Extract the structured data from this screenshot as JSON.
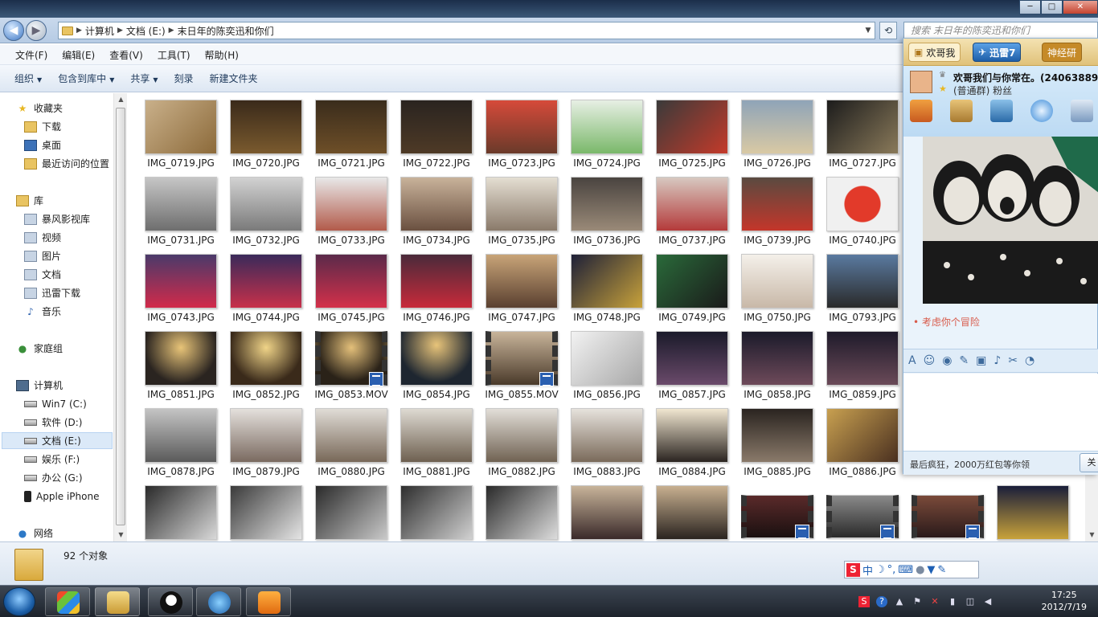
{
  "window": {
    "title_buttons": [
      "─",
      "□",
      "✕"
    ]
  },
  "address": {
    "crumbs": [
      "计算机",
      "文档 (E:)",
      "末日年的陈奕迅和你们"
    ],
    "search_placeholder": "搜索 末日年的陈奕迅和你们"
  },
  "menu": [
    "文件(F)",
    "编辑(E)",
    "查看(V)",
    "工具(T)",
    "帮助(H)"
  ],
  "commands": [
    "组织",
    "包含到库中",
    "共享",
    "刻录",
    "新建文件夹"
  ],
  "nav": {
    "favorites": "收藏夹",
    "fav_items": [
      "下载",
      "桌面",
      "最近访问的位置"
    ],
    "libraries": "库",
    "lib_items": [
      "暴风影视库",
      "视频",
      "图片",
      "文档",
      "迅雷下载",
      "音乐"
    ],
    "homegroup": "家庭组",
    "computer": "计算机",
    "drives": [
      "Win7 (C:)",
      "软件 (D:)",
      "文档 (E:)",
      "娱乐 (F:)",
      "办公 (G:)",
      "Apple iPhone"
    ],
    "network": "网络"
  },
  "files": [
    [
      "IMG_0719.JPG",
      "IMG_0720.JPG",
      "IMG_0721.JPG",
      "IMG_0722.JPG",
      "IMG_0723.JPG",
      "IMG_0724.JPG",
      "IMG_0725.JPG",
      "IMG_0726.JPG",
      "IMG_0727.JPG"
    ],
    [
      "IMG_0731.JPG",
      "IMG_0732.JPG",
      "IMG_0733.JPG",
      "IMG_0734.JPG",
      "IMG_0735.JPG",
      "IMG_0736.JPG",
      "IMG_0737.JPG",
      "IMG_0739.JPG",
      "IMG_0740.JPG"
    ],
    [
      "IMG_0743.JPG",
      "IMG_0744.JPG",
      "IMG_0745.JPG",
      "IMG_0746.JPG",
      "IMG_0747.JPG",
      "IMG_0748.JPG",
      "IMG_0749.JPG",
      "IMG_0750.JPG",
      "IMG_0793.JPG"
    ],
    [
      "IMG_0851.JPG",
      "IMG_0852.JPG",
      "IMG_0853.MOV",
      "IMG_0854.JPG",
      "IMG_0855.MOV",
      "IMG_0856.JPG",
      "IMG_0857.JPG",
      "IMG_0858.JPG",
      "IMG_0859.JPG"
    ],
    [
      "IMG_0878.JPG",
      "IMG_0879.JPG",
      "IMG_0880.JPG",
      "IMG_0881.JPG",
      "IMG_0882.JPG",
      "IMG_0883.JPG",
      "IMG_0884.JPG",
      "IMG_0885.JPG",
      "IMG_0886.JPG"
    ]
  ],
  "status": {
    "count": "92 个对象"
  },
  "ime": {
    "mode": "中"
  },
  "clock": {
    "time": "17:25",
    "date": "2012/7/19"
  },
  "qq": {
    "tab_left": "欢哥我",
    "tab_mid": "迅雷7",
    "tab_right": "神经研",
    "chat_title": "欢哥我们与你常在。(24063889",
    "chat_sub": "(普通群) 粉丝",
    "message": "• 考虑你个冒险",
    "ad": "最后疯狂，2000万红包等你领",
    "send": "关"
  },
  "colors": {
    "accent": "#3c76c4",
    "selection": "#dbe9f8",
    "qq_msg": "#d85a4a"
  }
}
